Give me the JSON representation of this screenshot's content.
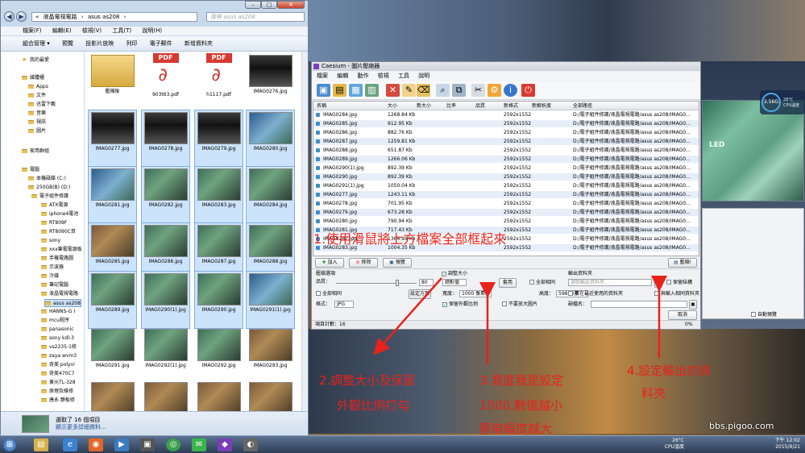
{
  "explorer": {
    "breadcrumb": [
      "«",
      "液晶電視電路",
      "›",
      "asus as208",
      "›"
    ],
    "search_placeholder": "搜尋 asus as208",
    "menu": [
      "檔案(F)",
      "編輯(E)",
      "檢視(V)",
      "工具(T)",
      "說明(H)"
    ],
    "toolbar": [
      "組合管理 ▾",
      "預覽",
      "投影片放映",
      "列印",
      "電子郵件",
      "新增資料夾"
    ],
    "nav": {
      "favorites": "我的最愛",
      "libraries": "媒體櫃",
      "lib_items": [
        "Apps",
        "文件",
        "迅雷下載",
        "音樂",
        "視訊",
        "圖片"
      ],
      "homegroup": "家用群組",
      "computer": "電腦",
      "drives": [
        "本機磁碟 (C:)",
        "250GB(B) (D:)"
      ],
      "folders": [
        "電子組件修護",
        "ATX電源",
        "iphone4電池",
        "RT809F",
        "RT8090C資",
        "sony",
        "xxx筆電電源板",
        "手機電路圖",
        "示波器",
        "冷媒",
        "筆記電腦",
        "液晶電視電路",
        "asus as208",
        "HANNS-G I",
        "mcu程序",
        "panasonic",
        "sony kdl-3",
        "vs2235-1修",
        "zaya wvm3",
        "奇美 polyvi",
        "奇美470C7",
        "東元TL-328",
        "原理及維修",
        "唐永 靜板修"
      ]
    },
    "files": [
      {
        "name": "壓縮後",
        "kind": "folder"
      },
      {
        "name": "903t63.pdf",
        "kind": "pdf"
      },
      {
        "name": "h1117.pdf",
        "kind": "pdf"
      },
      {
        "name": "IMAG0276.jpg",
        "kind": "photo1"
      },
      {
        "name": "IMAG0277.jpg",
        "kind": "photo1"
      },
      {
        "name": "IMAG0278.jpg",
        "kind": "photo1"
      },
      {
        "name": "IMAG0279.jpg",
        "kind": "photo1"
      },
      {
        "name": "IMAG0280.jpg",
        "kind": "photo4"
      },
      {
        "name": "IMAG0281.jpg",
        "kind": "photo4"
      },
      {
        "name": "IMAG0282.jpg",
        "kind": "photo2"
      },
      {
        "name": "IMAG0283.jpg",
        "kind": "photo2"
      },
      {
        "name": "IMAG0284.jpg",
        "kind": "photo2"
      },
      {
        "name": "IMAG0285.jpg",
        "kind": "photo3"
      },
      {
        "name": "IMAG0286.jpg",
        "kind": "photo2"
      },
      {
        "name": "IMAG0287.jpg",
        "kind": "photo2"
      },
      {
        "name": "IMAG0288.jpg",
        "kind": "photo2"
      },
      {
        "name": "IMAG0289.jpg",
        "kind": "photo2"
      },
      {
        "name": "IMAG0290(1).jpg",
        "kind": "photo2"
      },
      {
        "name": "IMAG0290.jpg",
        "kind": "photo2"
      },
      {
        "name": "IMAG0291(1).jpg",
        "kind": "photo4"
      },
      {
        "name": "IMAG0291.jpg",
        "kind": "photo2"
      },
      {
        "name": "IMAG0292(1).jpg",
        "kind": "photo2"
      },
      {
        "name": "IMAG0292.jpg",
        "kind": "photo2"
      },
      {
        "name": "IMAG0293.jpg",
        "kind": "photo3"
      },
      {
        "name": "IMAG0294.jpg",
        "kind": "photo3"
      },
      {
        "name": "IMAG0295.jpg",
        "kind": "photo3"
      },
      {
        "name": "IMAG0296.jpg",
        "kind": "photo3"
      },
      {
        "name": "IMAG0297.jpg",
        "kind": "photo3"
      }
    ],
    "details_line1": "選取了 16 個項目",
    "details_line2": "顯示更多詳細資料..."
  },
  "caesium": {
    "title": "Caesium - 圖片壓縮器",
    "menu": [
      "檔案",
      "編輯",
      "動作",
      "檢視",
      "工具",
      "說明"
    ],
    "columns": [
      "名稱",
      "大小",
      "新大小",
      "比率",
      "品質",
      "新格式",
      "新解析度",
      "全部路徑"
    ],
    "rows": [
      [
        "IMAG0284.jpg",
        "1268.84 Kb",
        "2592x1552",
        "D:/電子組件修護/液晶電視電路/asus as208/IMAG0..."
      ],
      [
        "IMAG0285.jpg",
        "912.95 Kb",
        "2592x1552",
        "D:/電子組件修護/液晶電視電路/asus as208/IMAG0..."
      ],
      [
        "IMAG0286.jpg",
        "882.76 Kb",
        "2592x1552",
        "D:/電子組件修護/液晶電視電路/asus as208/IMAG0..."
      ],
      [
        "IMAG0287.jpg",
        "1259.81 Kb",
        "2592x1552",
        "D:/電子組件修護/液晶電視電路/asus as208/IMAG0..."
      ],
      [
        "IMAG0288.jpg",
        "651.87 Kb",
        "2592x1552",
        "D:/電子組件修護/液晶電視電路/asus as208/IMAG0..."
      ],
      [
        "IMAG0289.jpg",
        "1266.06 Kb",
        "2592x1552",
        "D:/電子組件修護/液晶電視電路/asus as208/IMAG0..."
      ],
      [
        "IMAG0290(1).jpg",
        "892.39 Kb",
        "2592x1552",
        "D:/電子組件修護/液晶電視電路/asus as208/IMAG0..."
      ],
      [
        "IMAG0290.jpg",
        "892.39 Kb",
        "2592x1552",
        "D:/電子組件修護/液晶電視電路/asus as208/IMAG0..."
      ],
      [
        "IMAG0291(1).jpg",
        "1050.04 Kb",
        "2592x1552",
        "D:/電子組件修護/液晶電視電路/asus as208/IMAG0..."
      ],
      [
        "IMAG0277.jpg",
        "1243.11 Kb",
        "2592x1552",
        "D:/電子組件修護/液晶電視電路/asus as208/IMAG0..."
      ],
      [
        "IMAG0278.jpg",
        "701.95 Kb",
        "2592x1552",
        "D:/電子組件修護/液晶電視電路/asus as208/IMAG0..."
      ],
      [
        "IMAG0279.jpg",
        "673.28 Kb",
        "2592x1552",
        "D:/電子組件修護/液晶電視電路/asus as208/IMAG0..."
      ],
      [
        "IMAG0280.jpg",
        "790.94 Kb",
        "2592x1552",
        "D:/電子組件修護/液晶電視電路/asus as208/IMAG0..."
      ],
      [
        "IMAG0281.jpg",
        "717.43 Kb",
        "2592x1552",
        "D:/電子組件修護/液晶電視電路/asus as208/IMAG0..."
      ],
      [
        "IMAG0282.jpg",
        "1364.99 Kb",
        "2592x1552",
        "D:/電子組件修護/液晶電視電路/asus as208/IMAG0..."
      ],
      [
        "IMAG0283.jpg",
        "1004.35 Kb",
        "2592x1552",
        "D:/電子組件修護/液晶電視電路/asus as208/IMAG0..."
      ]
    ],
    "buttons": {
      "add": "加入",
      "remove": "移除",
      "preview": "預覽",
      "compress": "壓縮!"
    },
    "options": {
      "compress_title": "壓縮選項",
      "quality_label": "品質：",
      "quality_value": "80",
      "same_all": "全部相同",
      "format_label": "格式：",
      "format_value": "JPG",
      "resize": "調整大小",
      "resize_mode": "絕對值",
      "width_label": "寬度：",
      "width_value": "1000 像素",
      "height_label": "高度：",
      "height_value": "598 像素",
      "keep_ratio": "保留外觀比例",
      "no_enlarge": "不要放大圖片",
      "apply": "套用",
      "all_same2": "全部相同",
      "set_btn": "設定方案",
      "output_title": "輸出資料夾",
      "output_placeholder": "選取輸出資料夾...",
      "keep_structure": "保留結構",
      "same_as_input": "與輸入相同資料夾",
      "store_same": "放在最近使用的資料夾",
      "suffix_label": "副檔名：",
      "cancel": "取消",
      "progress": "0%",
      "auto_preview": "自動預覽"
    },
    "status": "項目計數：16"
  },
  "gauge": {
    "value": "2.56G",
    "temp": "28°C",
    "label": "CPU溫度"
  },
  "annotations": {
    "a1": "1.使用滑鼠將上方檔案全部框起來",
    "a2_l1": "2.調整大小及保留",
    "a2_l2": "外觀比例打勾",
    "a3_l1": "3.寬度我是設定",
    "a3_l2": "1000,數值越小",
    "a3_l3": "壓縮幅度越大",
    "a4_l1": "4.設定輸出的資",
    "a4_l2": "料夾"
  },
  "taskbar": {
    "time": "下午 12:02",
    "date": "2015/9/21",
    "cpu": "CPU溫度",
    "temp": "26°C"
  },
  "watermark": "bbs.pigoo.com",
  "colors": {
    "annotation": "#e8221c",
    "selection": "#cce4fb"
  }
}
